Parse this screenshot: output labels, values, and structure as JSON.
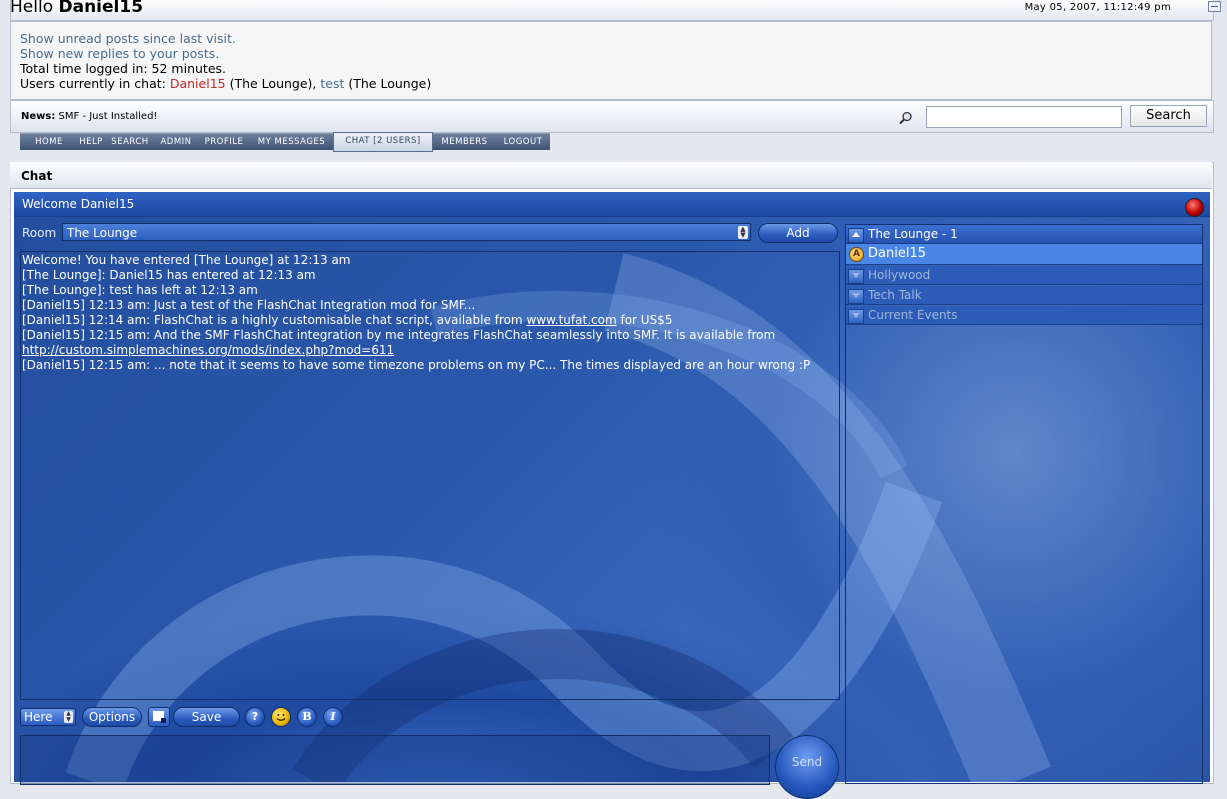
{
  "header": {
    "greeting": "Hello",
    "username": "Daniel15",
    "datetime": "May 05, 2007, 11:12:49 pm"
  },
  "info": {
    "unread_link": "Show unread posts since last visit.",
    "replies_link": "Show new replies to your posts.",
    "time_logged": "Total time logged in: 52 minutes.",
    "chat_prefix": "Users currently in chat:",
    "chat_user1": "Daniel15",
    "chat_room1": "(The Lounge),",
    "chat_user2": "test",
    "chat_room2": "(The Lounge)"
  },
  "news": {
    "label": "News:",
    "text": "SMF - Just Installed!"
  },
  "search": {
    "button_label": "Search",
    "value": ""
  },
  "menu": {
    "tabs": [
      "HOME",
      "HELP",
      "SEARCH",
      "ADMIN",
      "PROFILE",
      "MY MESSAGES",
      "CHAT [2 USERS]",
      "MEMBERS",
      "LOGOUT"
    ],
    "active": "CHAT [2 USERS]"
  },
  "chat": {
    "section_title": "Chat",
    "welcome": "Welcome Daniel15",
    "room_label": "Room",
    "room_value": "The Lounge",
    "add_label": "Add",
    "messages": [
      "Welcome! You have entered [The Lounge] at 12:13 am",
      "[The Lounge]: Daniel15 has entered at 12:13 am",
      "[The Lounge]: test has left at 12:13 am",
      "[Daniel15] 12:13 am: Just a test of the FlashChat Integration mod for SMF...",
      "[Daniel15] 12:14 am: FlashChat is a highly customisable chat script, available from",
      "www.tufat.com",
      "for US$5",
      "[Daniel15] 12:15 am: And the SMF FlashChat integration by me integrates FlashChat seamlessly into SMF. It is available from",
      "http://custom.simplemachines.org/mods/index.php?mod=611",
      "[Daniel15] 12:15 am: ... note that it seems to have some timezone problems on my PC... The times displayed are an hour wrong :P"
    ],
    "rooms": [
      {
        "name": "The Lounge - 1",
        "expanded": true
      },
      {
        "name": "Daniel15",
        "is_user": true
      },
      {
        "name": "Hollywood"
      },
      {
        "name": "Tech Talk"
      },
      {
        "name": "Current Events"
      }
    ],
    "target_select": "Here",
    "options_label": "Options",
    "save_label": "Save",
    "help_label": "?",
    "bold_label": "B",
    "italic_label": "I",
    "send_label": "Send"
  }
}
